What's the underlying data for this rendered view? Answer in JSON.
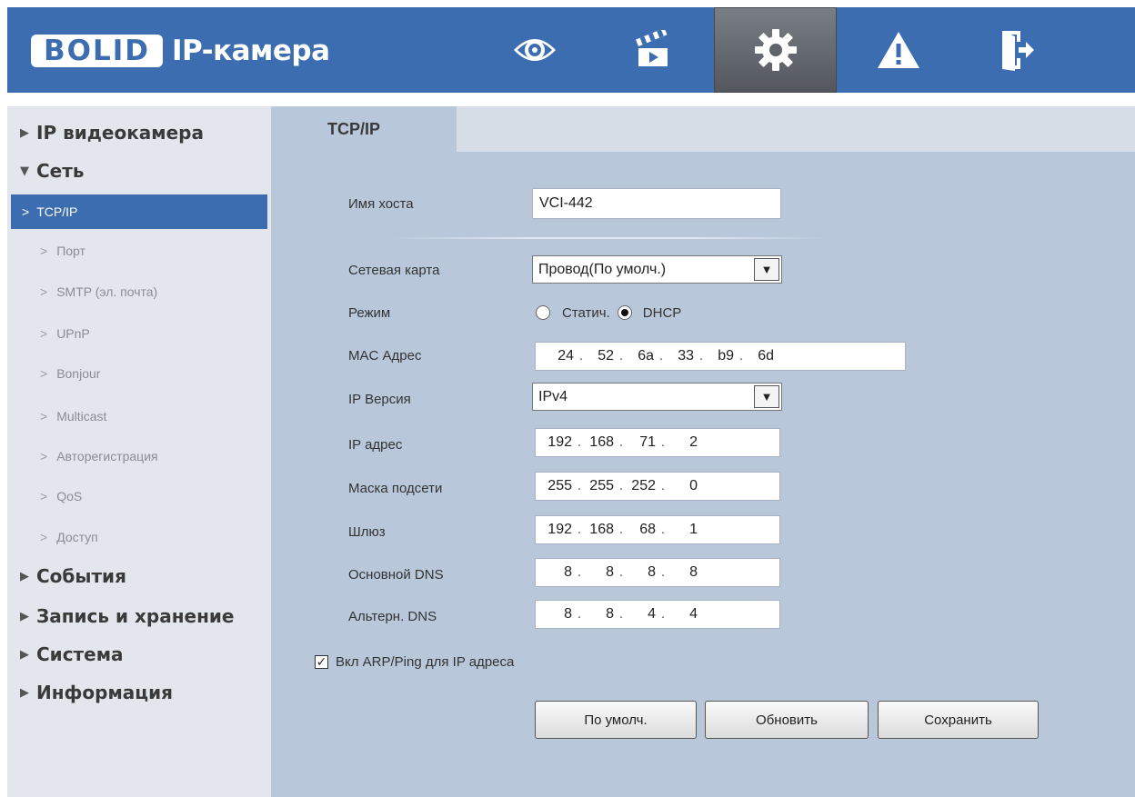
{
  "header": {
    "logo_text": "BOLID",
    "app_title": "IP-камера",
    "nav": [
      {
        "icon": "eye-icon"
      },
      {
        "icon": "clapperboard-icon"
      },
      {
        "icon": "gear-icon",
        "active": true
      },
      {
        "icon": "warning-icon"
      },
      {
        "icon": "exit-door-icon"
      }
    ],
    "colors": {
      "bar": "#3d6db1",
      "active_tab": "#5f636a"
    }
  },
  "sidebar": {
    "main": {
      "ip_camera": "IP видеокамера",
      "network": "Сеть",
      "events": "События",
      "recording": "Запись и хранение",
      "system": "Система",
      "info": "Информация"
    },
    "network_items": [
      "TCP/IP",
      "Порт",
      "SMTP (эл. почта)",
      "UPnP",
      "Bonjour",
      "Multicast",
      "Авторегистрация",
      "QoS",
      "Доступ"
    ],
    "active_item": "TCP/IP"
  },
  "tab": {
    "label": "TCP/IP"
  },
  "form": {
    "hostname_label": "Имя хоста",
    "hostname_value": "VCI-442",
    "nic_label": "Сетевая карта",
    "nic_value": "Провод(По умолч.)",
    "mode_label": "Режим",
    "mode_static": "Статич.",
    "mode_dhcp": "DHCP",
    "mode_selected": "DHCP",
    "mac_label": "MAC Адрес",
    "mac_parts": [
      "24",
      "52",
      "6a",
      "33",
      "b9",
      "6d"
    ],
    "ipver_label": "IP Версия",
    "ipver_value": "IPv4",
    "ip_label": "IP адрес",
    "ip_parts": [
      "192",
      "168",
      "71",
      "2"
    ],
    "mask_label": "Маска подсети",
    "mask_parts": [
      "255",
      "255",
      "252",
      "0"
    ],
    "gateway_label": "Шлюз",
    "gateway_parts": [
      "192",
      "168",
      "68",
      "1"
    ],
    "dns1_label": "Основной DNS",
    "dns1_parts": [
      "8",
      "8",
      "8",
      "8"
    ],
    "dns2_label": "Альтерн. DNS",
    "dns2_parts": [
      "8",
      "8",
      "4",
      "4"
    ],
    "arp_label": "Вкл ARP/Ping для IP адреса",
    "arp_checked": true
  },
  "buttons": {
    "default": "По умолч.",
    "refresh": "Обновить",
    "save": "Сохранить"
  }
}
